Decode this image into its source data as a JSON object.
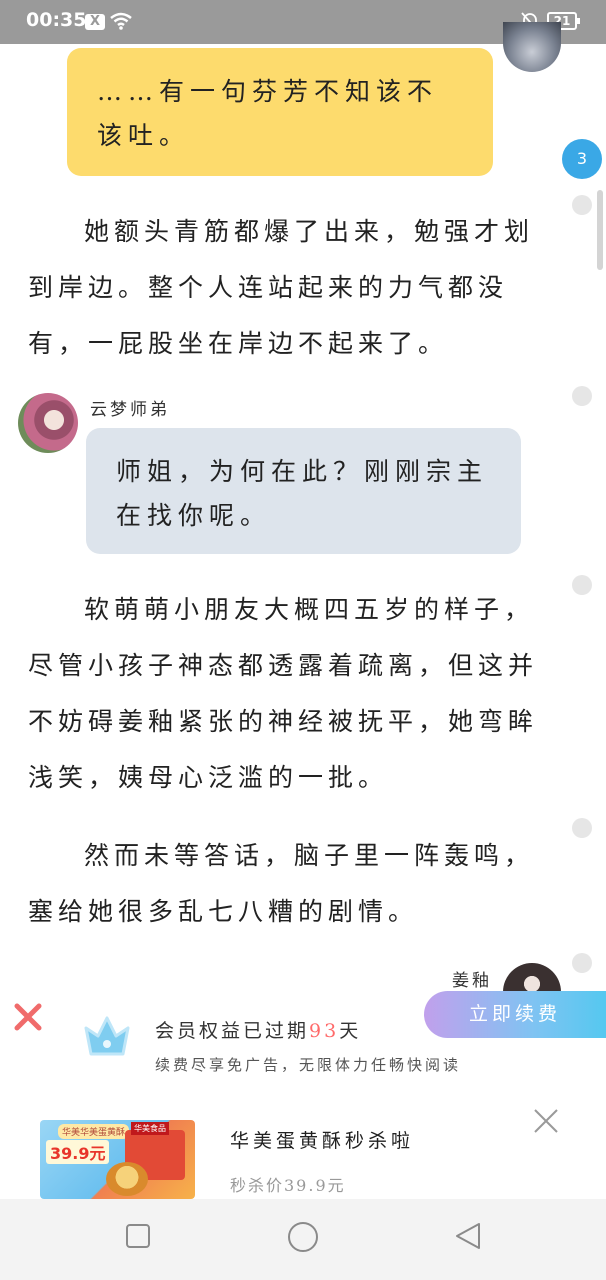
{
  "status_bar": {
    "time": "00:35",
    "notification_badge": "X",
    "battery_level": "21"
  },
  "messages": {
    "yellow_bubble": "……有一句芬芳不知该不该吐。",
    "paragraph_1": "她额头青筋都爆了出来，勉强才划到岸边。整个人连站起来的力气都没有，一屁股坐在岸边不起来了。",
    "speaker_2": "云梦师弟",
    "blue_bubble": "师姐，为何在此？刚刚宗主在找你呢。",
    "paragraph_2": "软萌萌小朋友大概四五岁的样子，尽管小孩子神态都透露着疏离，但这并不妨碍姜釉紧张的神经被抚平，她弯眸浅笑，姨母心泛滥的一批。",
    "paragraph_3": "然而未等答话，脑子里一阵轰鸣，塞给她很多乱七八糟的剧情。",
    "speaker_3": "姜釉"
  },
  "comment_badge": "3",
  "vip_banner": {
    "title_prefix": "会员权益已过期",
    "days": "93",
    "title_suffix": "天",
    "subtitle": "续费尽享免广告，无限体力任畅快阅读",
    "renew_button": "立即续费"
  },
  "ad": {
    "title": "华美蛋黄酥秒杀啦",
    "price_text": "秒杀价39.9元",
    "image_tag": "华美华美蛋黄酥",
    "image_price": "39.9元",
    "image_logo": "华美食品"
  },
  "icons": {
    "wifi": "wifi-icon",
    "mute": "bell-muted-icon",
    "close_vip": "close-x-icon",
    "crown": "crown-icon",
    "close_ad": "close-icon",
    "nav_recent": "square-icon",
    "nav_home": "circle-icon",
    "nav_back": "triangle-back-icon"
  },
  "colors": {
    "yellow_bubble": "#fddb6d",
    "blue_bubble": "#dde4ec",
    "badge": "#3aa8e6",
    "days_highlight": "#ff6a6a",
    "close_red": "#f06b6b"
  }
}
